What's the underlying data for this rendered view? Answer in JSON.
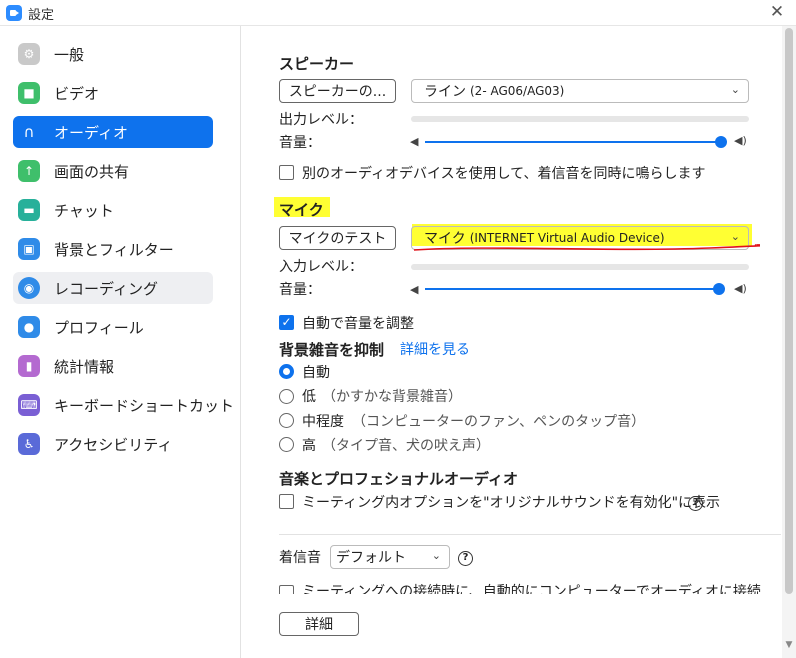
{
  "window": {
    "title": "設定"
  },
  "sidebar": {
    "items": [
      {
        "label": "一般",
        "icon": "gear-icon",
        "color": "#c9c9c9"
      },
      {
        "label": "ビデオ",
        "icon": "video-icon",
        "color": "#3fbf6b"
      },
      {
        "label": "オーディオ",
        "icon": "headphones-icon",
        "color": "#0e72ed"
      },
      {
        "label": "画面の共有",
        "icon": "share-screen-icon",
        "color": "#3fbf6b"
      },
      {
        "label": "チャット",
        "icon": "chat-icon",
        "color": "#27b09a"
      },
      {
        "label": "背景とフィルター",
        "icon": "background-icon",
        "color": "#2f8be8"
      },
      {
        "label": "レコーディング",
        "icon": "record-icon",
        "color": "#2f8be8"
      },
      {
        "label": "プロフィール",
        "icon": "profile-icon",
        "color": "#2f8be8"
      },
      {
        "label": "統計情報",
        "icon": "stats-icon",
        "color": "#b46ad0"
      },
      {
        "label": "キーボードショートカット",
        "icon": "keyboard-icon",
        "color": "#7a5fd4"
      },
      {
        "label": "アクセシビリティ",
        "icon": "accessibility-icon",
        "color": "#5a6ad8"
      }
    ],
    "active_index": 2,
    "hover_index": 6
  },
  "speaker": {
    "title": "スピーカー",
    "test_button": "スピーカーの...",
    "device_main": "ライン",
    "device_sub": "(2- AG06/AG03)",
    "output_level_label": "出力レベル：",
    "volume_label": "音量："
  },
  "separate_device": {
    "label": "別のオーディオデバイスを使用して、着信音を同時に鳴らします",
    "checked": false
  },
  "mic": {
    "title": "マイク",
    "test_button": "マイクのテスト",
    "device_main": "マイク",
    "device_sub": "(INTERNET Virtual Audio Device)",
    "input_level_label": "入力レベル：",
    "volume_label": "音量："
  },
  "auto_volume": {
    "label": "自動で音量を調整",
    "checked": true
  },
  "noise": {
    "title": "背景雑音を抑制",
    "link": "詳細を見る",
    "options": [
      {
        "label": "自動",
        "hint": ""
      },
      {
        "label": "低",
        "hint": "（かすかな背景雑音）"
      },
      {
        "label": "中程度",
        "hint": "（コンピューターのファン、ペンのタップ音）"
      },
      {
        "label": "高",
        "hint": "（タイプ音、犬の吠え声）"
      }
    ],
    "selected_index": 0
  },
  "music": {
    "title": "音楽とプロフェショナルオーディオ",
    "option": "ミーティング内オプションを\"オリジナルサウンドを有効化\"に表示",
    "help": "?"
  },
  "ringtone": {
    "label": "着信音",
    "value": "デフォルト",
    "help": "?"
  },
  "auto_join": {
    "label": "ミーティングへの接続時に、自動的にコンピューターでオーディオに接続"
  },
  "advanced_button": "詳細",
  "colors": {
    "accent": "#0e72ed",
    "highlight": "#ffff33",
    "annotation": "#e0121a"
  }
}
